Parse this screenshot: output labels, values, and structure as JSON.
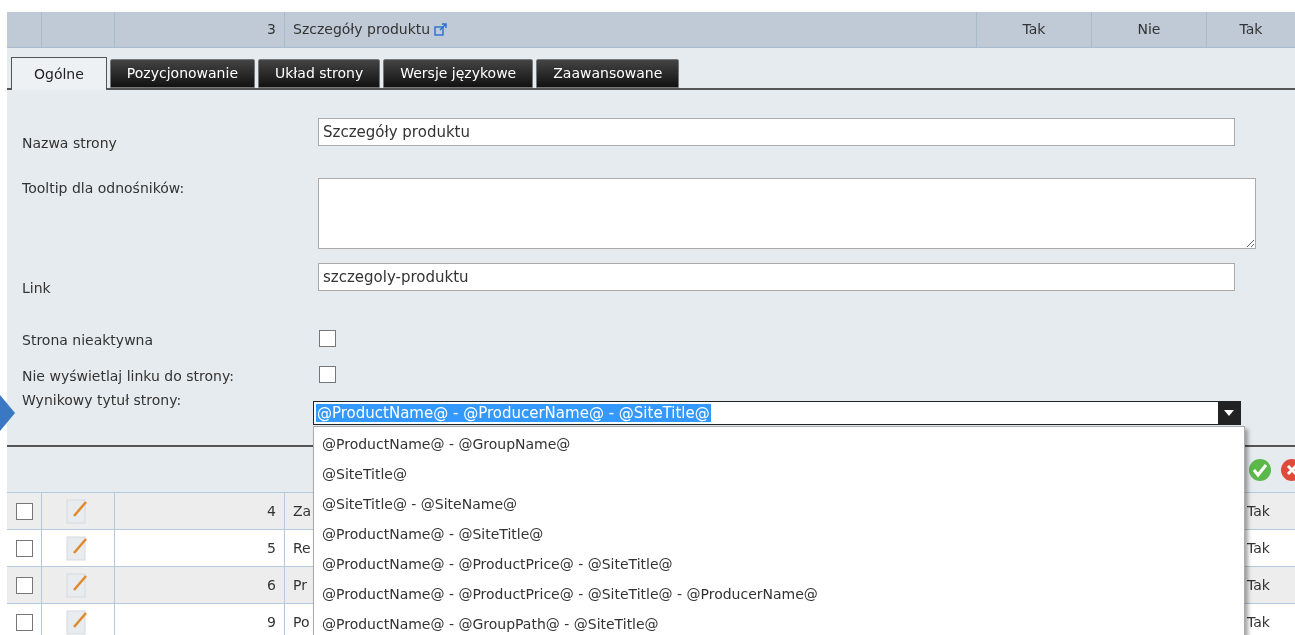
{
  "header_row": {
    "number": "3",
    "name": "Szczegóły produktu",
    "col_5": "Tak",
    "col_6": "Nie",
    "col_7": "Tak"
  },
  "tabs": [
    {
      "label": "Ogólne",
      "selected": true
    },
    {
      "label": "Pozycjonowanie",
      "selected": false
    },
    {
      "label": "Układ strony",
      "selected": false
    },
    {
      "label": "Wersje językowe",
      "selected": false
    },
    {
      "label": "Zaawansowane",
      "selected": false
    }
  ],
  "form": {
    "fields": [
      {
        "kind": "text",
        "label": "Nazwa strony",
        "value": "Szczegóły produktu"
      },
      {
        "kind": "textarea",
        "label": "Tooltip dla odnośników:"
      },
      {
        "kind": "text",
        "label": "Link",
        "value": "szczegoly-produktu"
      },
      {
        "kind": "checkbox",
        "label": "Strona nieaktywna",
        "checked": false
      },
      {
        "kind": "checkbox",
        "label": "Nie wyświetlaj linku do strony:",
        "checked": false
      },
      {
        "kind": "select",
        "label": "Wynikowy tytuł strony:",
        "value": "@ProductName@ - @ProducerName@ - @SiteTitle@",
        "expanded": true,
        "options": [
          {
            "label": "@ProductName@ - @GroupName@",
            "selected": false
          },
          {
            "label": "@SiteTitle@",
            "selected": false
          },
          {
            "label": "@SiteTitle@ - @SiteName@",
            "selected": false
          },
          {
            "label": "@ProductName@ - @SiteTitle@",
            "selected": false
          },
          {
            "label": "@ProductName@ - @ProductPrice@ - @SiteTitle@",
            "selected": false
          },
          {
            "label": "@ProductName@ - @ProductPrice@ - @SiteTitle@ - @ProducerName@",
            "selected": false
          },
          {
            "label": "@ProductName@ - @GroupPath@ - @SiteTitle@",
            "selected": false
          }
        ]
      }
    ]
  },
  "rows": [
    {
      "checked": false,
      "number": "4",
      "name": "Za",
      "col_last": "Tak"
    },
    {
      "checked": false,
      "number": "5",
      "name": "Re",
      "col_last": "Tak"
    },
    {
      "checked": false,
      "number": "6",
      "name": "Pr",
      "col_last": "Tak"
    },
    {
      "checked": false,
      "number": "9",
      "name": "Po",
      "col_last": "Tak"
    }
  ]
}
